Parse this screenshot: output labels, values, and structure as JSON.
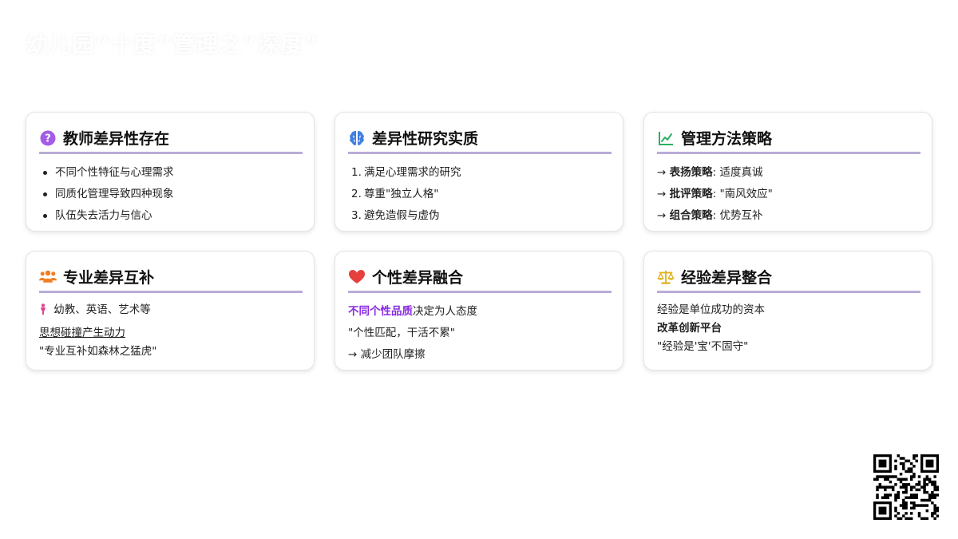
{
  "page_title": "幼儿园“十度”管理之“深度”",
  "cards": [
    {
      "title": "教师差异性存在",
      "icon": "question-circle-icon",
      "icon_color": "#a35ce6",
      "items": [
        "不同个性特征与心理需求",
        "同质化管理导致四种现象",
        "队伍失去活力与信心"
      ]
    },
    {
      "title": "差异性研究实质",
      "icon": "brain-icon",
      "icon_color": "#3f7fe0",
      "items": [
        {
          "num": "1.",
          "text": "满足心理需求的研究"
        },
        {
          "num": "2.",
          "text": "尊重\"独立人格\""
        },
        {
          "num": "3.",
          "text": "避免造假与虚伪"
        }
      ]
    },
    {
      "title": "管理方法策略",
      "icon": "line-chart-icon",
      "icon_color": "#2fae63",
      "items": [
        {
          "arrow": "→",
          "label": "表扬策略",
          "text": ": 适度真诚"
        },
        {
          "arrow": "→",
          "label": "批评策略",
          "text": ": \"南风效应\""
        },
        {
          "arrow": "→",
          "label": "组合策略",
          "text": ": 优势互补"
        }
      ]
    },
    {
      "title": "专业差异互补",
      "icon": "users-icon",
      "icon_color": "#ef7d22",
      "lines": {
        "person_icon": "person-icon",
        "person_icon_color": "#e0458f",
        "line1": "幼教、英语、艺术等",
        "line2": "思想碰撞产生动力",
        "line3": "\"专业互补如森林之猛虎\""
      }
    },
    {
      "title": "个性差异融合",
      "icon": "heart-icon",
      "icon_color": "#e6403d",
      "lines": {
        "highlight": "不同个性品质",
        "line1_rest": "决定为人态度",
        "line2": "\"个性匹配，干活不累\"",
        "line3": "→ 减少团队摩擦"
      }
    },
    {
      "title": "经验差异整合",
      "icon": "scale-icon",
      "icon_color": "#e2b21a",
      "lines": {
        "line1": "经验是单位成功的资本",
        "line2": "改革创新平台",
        "line3": "\"经验是'宝'不固守\""
      }
    }
  ],
  "accent_color": "#b9acd8",
  "qr_icon": "qr-code-icon"
}
